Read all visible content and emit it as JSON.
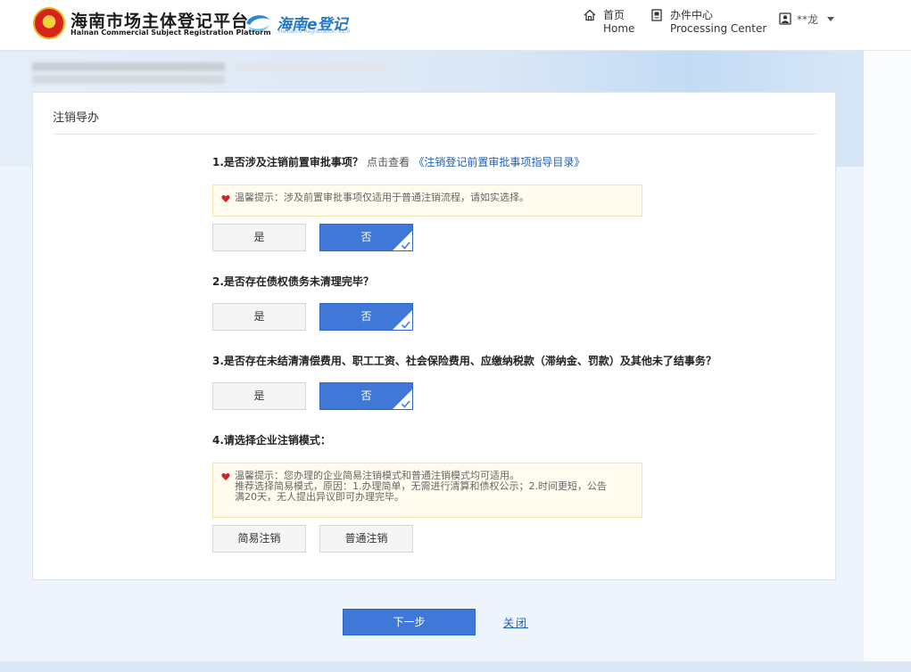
{
  "header": {
    "brand_title": "海南市场主体登记平台",
    "brand_subtitle": "Hainan Commercial Subject Registration Platform",
    "logo2_title": "海南e登记",
    "logo2_subtitle": "Hainan e Registration V2.0",
    "nav": [
      {
        "cn": "首页",
        "en": "Home",
        "icon": "home-icon"
      },
      {
        "cn": "办件中心",
        "en": "Processing Center",
        "icon": "document-icon"
      }
    ],
    "user_name": "**龙"
  },
  "card": {
    "title": "注销导办",
    "q1": {
      "label": "1.是否涉及注销前置审批事项？",
      "extra": "点击查看",
      "link": "《注销登记前置审批事项指导目录》",
      "tip": "温馨提示：涉及前置审批事项仅适用于普通注销流程，请如实选择。",
      "options": [
        "是",
        "否"
      ],
      "selected": "否"
    },
    "q2": {
      "label": "2.是否存在债权债务未清理完毕？",
      "options": [
        "是",
        "否"
      ],
      "selected": "否"
    },
    "q3": {
      "label": "3.是否存在未结清清偿费用、职工工资、社会保险费用、应缴纳税款（滞纳金、罚款）及其他未了结事务？",
      "options": [
        "是",
        "否"
      ],
      "selected": "否"
    },
    "q4": {
      "label": "4.请选择企业注销模式：",
      "tip_lines": [
        "温馨提示：您办理的企业简易注销模式和普通注销模式均可适用。",
        "推荐选择简易模式，原因：1.办理简单，无需进行清算和债权公示；2.时间更短，公告",
        "满20天，无人提出异议即可办理完毕。"
      ],
      "options": [
        "简易注销",
        "普通注销"
      ]
    }
  },
  "actions": {
    "next": "下一步",
    "close": "关闭"
  },
  "colors": {
    "primary": "#3f78d7",
    "link": "#1f5fb5",
    "tip_bg": "#fffbee",
    "heart": "#d0262a"
  }
}
